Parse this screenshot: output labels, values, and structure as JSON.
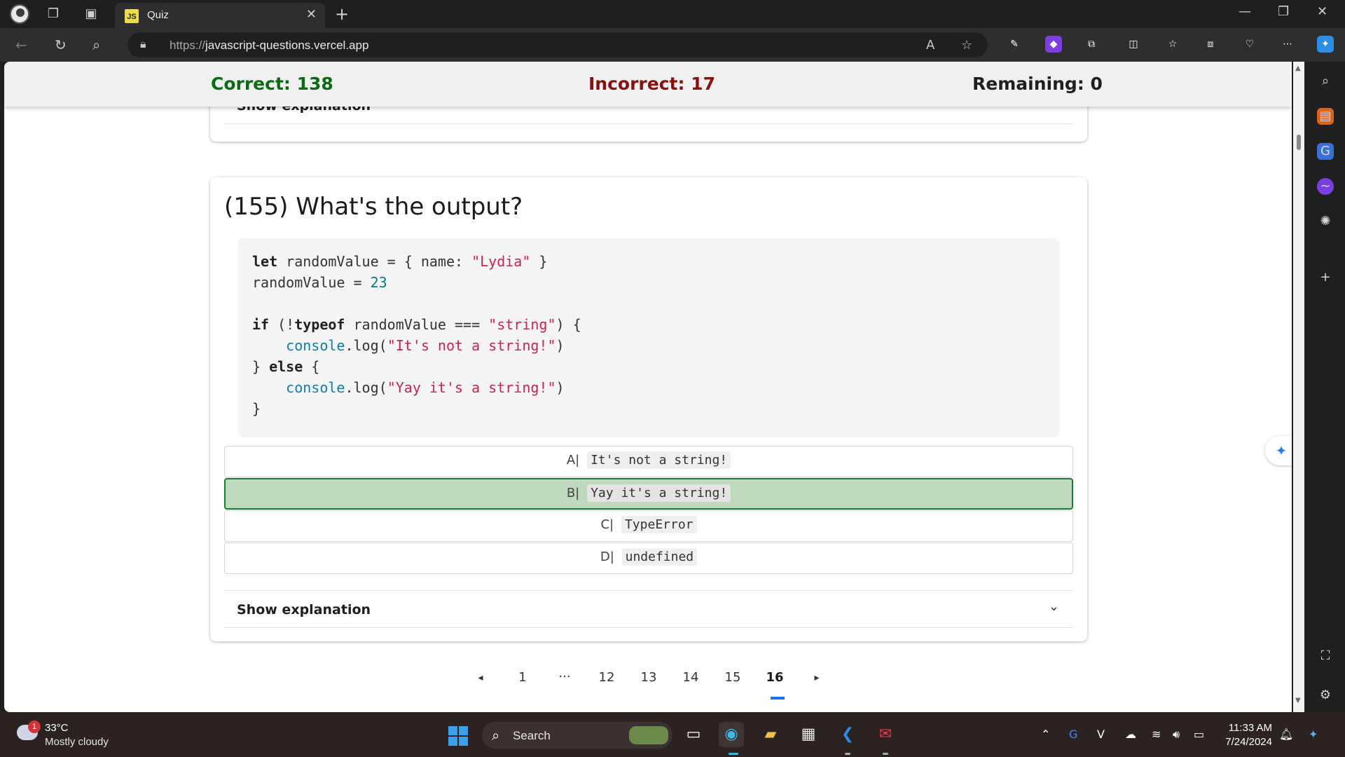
{
  "browser": {
    "tab_title": "Quiz",
    "tab_favicon_text": "JS",
    "url_protocol": "https://",
    "url_host": "javascript-questions.vercel.app"
  },
  "score": {
    "correct": "Correct: 138",
    "incorrect": "Incorrect: 17",
    "remaining": "Remaining: 0",
    "colors": {
      "correct": "#0b6b14",
      "incorrect": "#8a1010",
      "remaining": "#1f1f1f"
    }
  },
  "previous_card": {
    "explanation_label": "Show explanation"
  },
  "question": {
    "title": "(155) What's the output?",
    "code": {
      "line1": {
        "kw": "let",
        "a": " randomValue = { name: ",
        "str": "\"Lydia\"",
        "b": " }"
      },
      "line2": {
        "a": "randomValue = ",
        "num": "23"
      },
      "line4": {
        "kw1": "if",
        "a": " (!",
        "kw2": "typeof",
        "b": " randomValue === ",
        "str": "\"string\"",
        "c": ") {"
      },
      "line5": {
        "indent": "    ",
        "obj": "console",
        "a": ".log(",
        "str": "\"It's not a string!\"",
        "b": ")"
      },
      "line6": {
        "a": "} ",
        "kw": "else",
        "b": " {"
      },
      "line7": {
        "indent": "    ",
        "obj": "console",
        "a": ".log(",
        "str": "\"Yay it's a string!\"",
        "b": ")"
      },
      "line8": {
        "a": "}"
      }
    },
    "options": [
      {
        "letter": "A|",
        "text": "It's not a string!",
        "state": "default"
      },
      {
        "letter": "B|",
        "text": "Yay it's a string!",
        "state": "correct"
      },
      {
        "letter": "C|",
        "text": "TypeError",
        "state": "default"
      },
      {
        "letter": "D|",
        "text": "undefined",
        "state": "default"
      }
    ],
    "explanation_label": "Show explanation"
  },
  "pagination": {
    "prev": "◂",
    "pages": [
      "1",
      "...",
      "12",
      "13",
      "14",
      "15",
      "16"
    ],
    "active": "16",
    "next": "▸"
  },
  "taskbar": {
    "weather_badge": "1",
    "weather_temp": "33°C",
    "weather_desc": "Mostly cloudy",
    "search_label": "Search",
    "time": "11:33 AM",
    "date": "7/24/2024"
  },
  "icons": {
    "accent_blue": "#1a73e8",
    "correct_fill": "#bfd9bf",
    "correct_border": "#1e7a2e"
  }
}
